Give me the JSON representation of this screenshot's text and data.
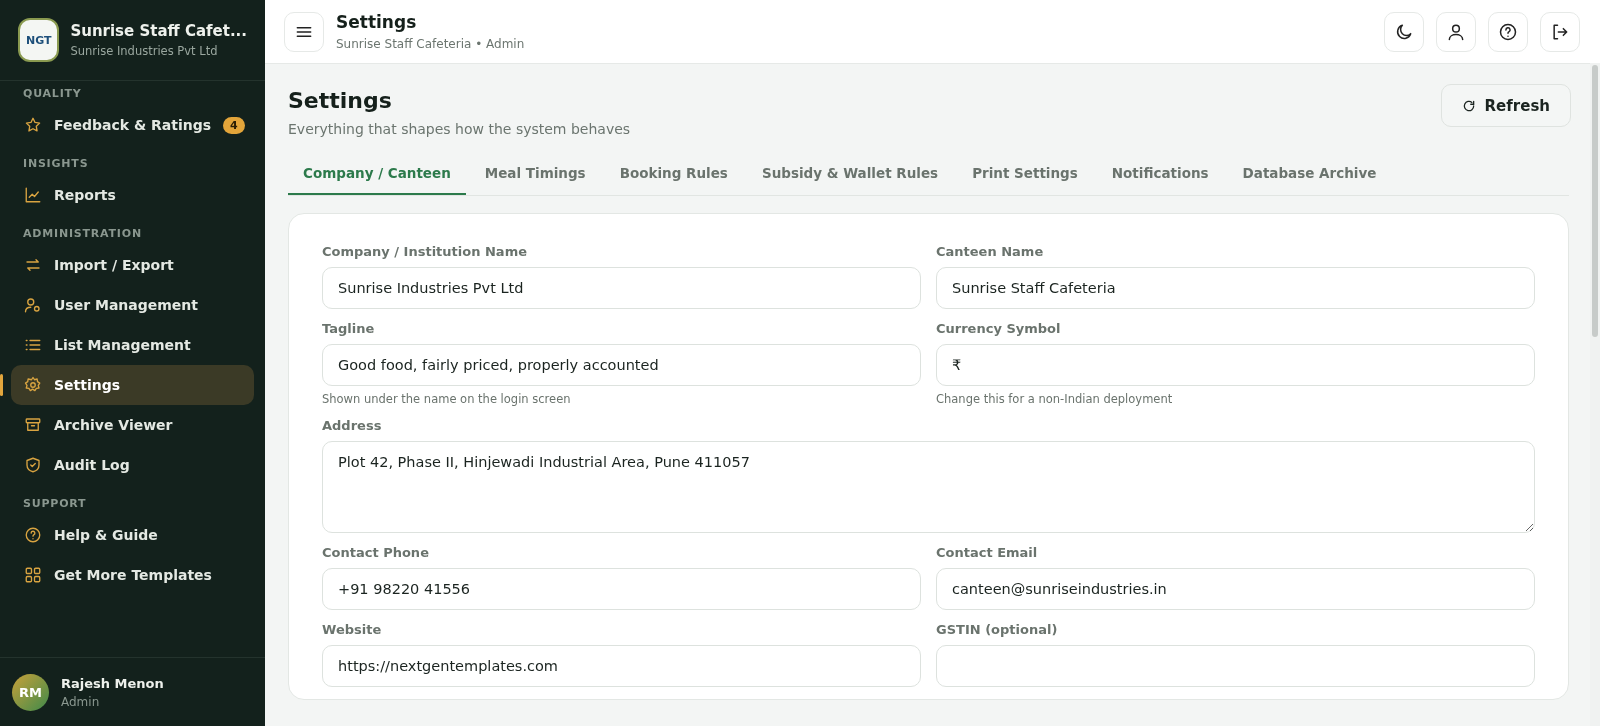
{
  "brand": {
    "logo_text": "NGT",
    "title": "Sunrise Staff Cafet...",
    "subtitle": "Sunrise Industries Pvt Ltd"
  },
  "sidebar": {
    "sections": [
      {
        "heading": "QUALITY",
        "items": [
          {
            "label": "Feedback & Ratings",
            "selected": false,
            "badge": "4"
          }
        ]
      },
      {
        "heading": "INSIGHTS",
        "items": [
          {
            "label": "Reports",
            "selected": false
          }
        ]
      },
      {
        "heading": "ADMINISTRATION",
        "items": [
          {
            "label": "Import / Export",
            "selected": false
          },
          {
            "label": "User Management",
            "selected": false
          },
          {
            "label": "List Management",
            "selected": false
          },
          {
            "label": "Settings",
            "selected": true
          },
          {
            "label": "Archive Viewer",
            "selected": false
          },
          {
            "label": "Audit Log",
            "selected": false
          }
        ]
      },
      {
        "heading": "SUPPORT",
        "items": [
          {
            "label": "Help & Guide",
            "selected": false
          },
          {
            "label": "Get More Templates",
            "selected": false
          }
        ]
      }
    ]
  },
  "user": {
    "initials": "RM",
    "name": "Rajesh Menon",
    "role": "Admin"
  },
  "topbar": {
    "title": "Settings",
    "subtitle": "Sunrise Staff Cafeteria • Admin"
  },
  "page": {
    "title": "Settings",
    "subtitle": "Everything that shapes how the system behaves",
    "refresh_button": "Refresh"
  },
  "tabs": [
    {
      "label": "Company / Canteen",
      "selected": true
    },
    {
      "label": "Meal Timings",
      "selected": false
    },
    {
      "label": "Booking Rules",
      "selected": false
    },
    {
      "label": "Subsidy & Wallet Rules",
      "selected": false
    },
    {
      "label": "Print Settings",
      "selected": false
    },
    {
      "label": "Notifications",
      "selected": false
    },
    {
      "label": "Database Archive",
      "selected": false
    }
  ],
  "form": {
    "fields": [
      {
        "kind": "input",
        "label": "Company / Institution Name",
        "value": "Sunrise Industries Pvt Ltd"
      },
      {
        "kind": "input",
        "label": "Canteen Name",
        "value": "Sunrise Staff Cafeteria"
      },
      {
        "kind": "input",
        "label": "Tagline",
        "value": "Good food, fairly priced, properly accounted",
        "hint": "Shown under the name on the login screen"
      },
      {
        "kind": "input",
        "label": "Currency Symbol",
        "value": "₹",
        "hint": "Change this for a non-Indian deployment"
      },
      {
        "kind": "textarea",
        "label": "Address",
        "value": "Plot 42, Phase II, Hinjewadi Industrial Area, Pune 411057"
      },
      {
        "kind": "input",
        "label": "Contact Phone",
        "value": "+91 98220 41556"
      },
      {
        "kind": "input",
        "label": "Contact Email",
        "value": "canteen@sunriseindustries.in"
      },
      {
        "kind": "input",
        "label": "Website",
        "value": "https://nextgentemplates.com"
      },
      {
        "kind": "input",
        "label": "GSTIN (optional)"
      }
    ]
  }
}
